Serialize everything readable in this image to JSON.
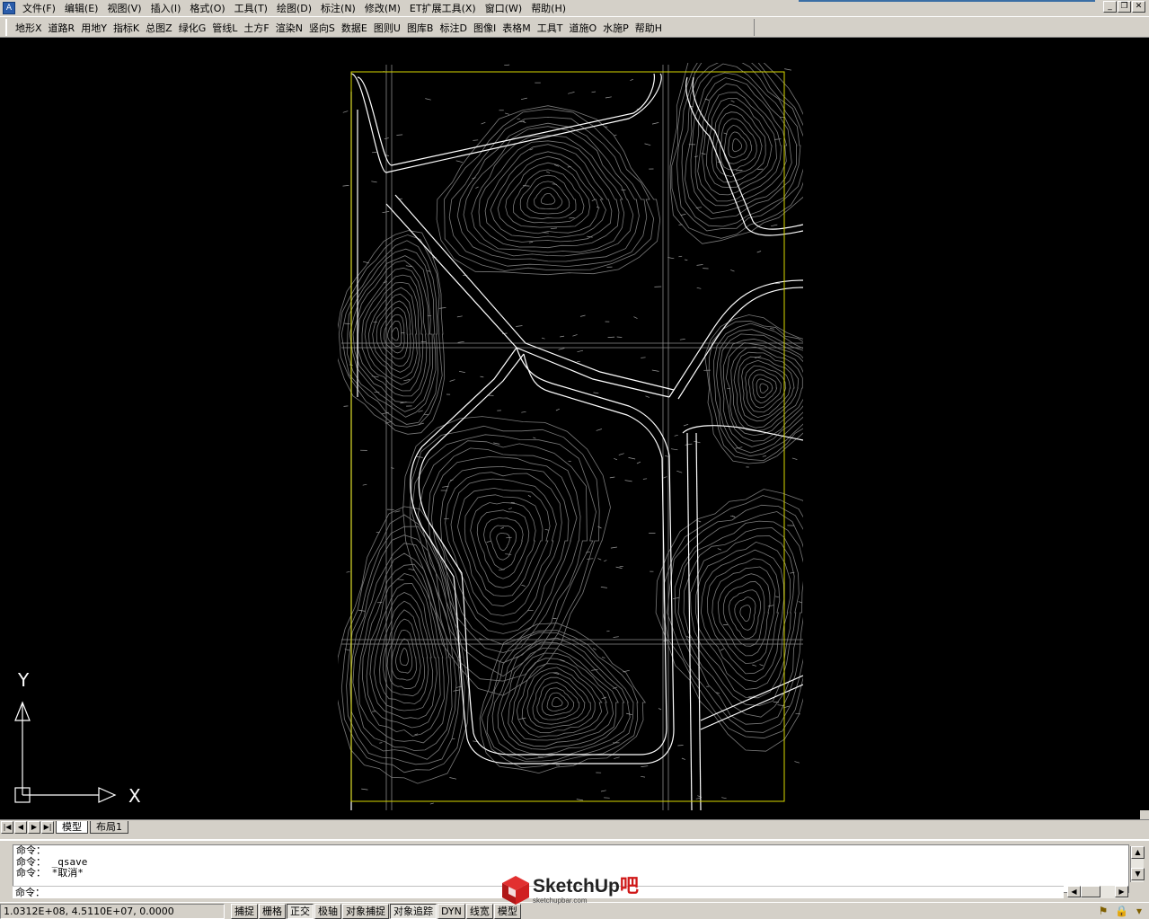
{
  "menu": {
    "items": [
      "文件(F)",
      "编辑(E)",
      "视图(V)",
      "插入(I)",
      "格式(O)",
      "工具(T)",
      "绘图(D)",
      "标注(N)",
      "修改(M)",
      "ET扩展工具(X)",
      "窗口(W)",
      "帮助(H)"
    ]
  },
  "window_controls": [
    "_",
    "❐",
    "✕"
  ],
  "toolbar": {
    "items": [
      "地形X",
      "道路R",
      "用地Y",
      "指标K",
      "总图Z",
      "绿化G",
      "管线L",
      "土方F",
      "渲染N",
      "竖向S",
      "数据E",
      "图则U",
      "图库B",
      "标注D",
      "图像I",
      "表格M",
      "工具T",
      "道施O",
      "水施P",
      "帮助H"
    ]
  },
  "ucs": {
    "y_label": "Y",
    "x_label": "X"
  },
  "tabs": {
    "nav": [
      "|◀",
      "◀",
      "▶",
      "▶|"
    ],
    "items": [
      "模型",
      "布局1"
    ],
    "active": "模型"
  },
  "command": {
    "lines": [
      "命令：",
      "命令： _qsave",
      "命令： *取消*"
    ],
    "prompt": "命令："
  },
  "status": {
    "coordinates": "1.0312E+08, 4.5110E+07, 0.0000",
    "buttons": [
      {
        "label": "捕捉",
        "on": false
      },
      {
        "label": "栅格",
        "on": false
      },
      {
        "label": "正交",
        "on": true
      },
      {
        "label": "极轴",
        "on": false
      },
      {
        "label": "对象捕捉",
        "on": false
      },
      {
        "label": "对象追踪",
        "on": true
      },
      {
        "label": "DYN",
        "on": false
      },
      {
        "label": "线宽",
        "on": false
      },
      {
        "label": "模型",
        "on": false
      }
    ]
  },
  "watermark": {
    "brand": "SketchUp",
    "brand_accent": "吧",
    "url": "sketchupbar.com"
  },
  "colors": {
    "canvas": "#000000",
    "drawing_frame": "#d8d800",
    "roads": "#ffffff",
    "contours": "#7a7a7a"
  }
}
